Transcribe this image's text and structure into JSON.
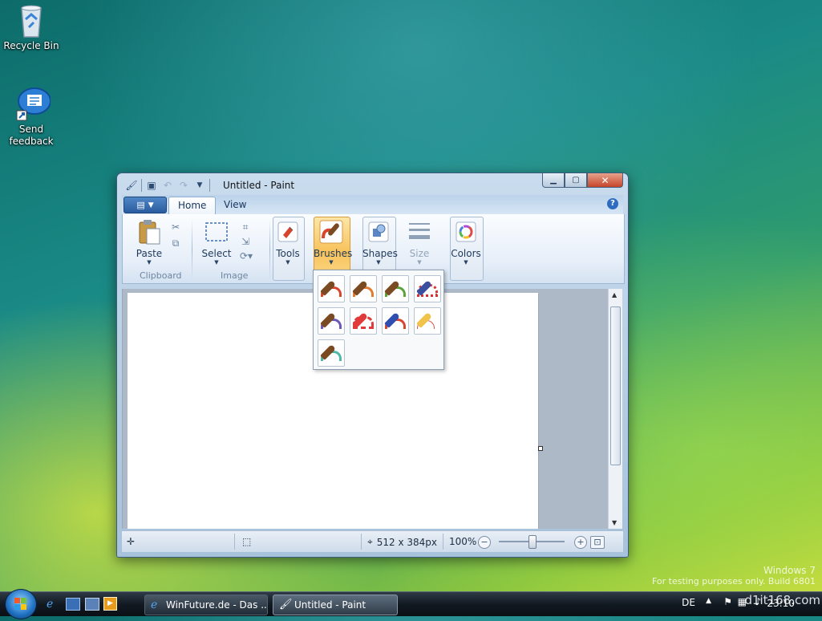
{
  "desktop": {
    "icons": [
      {
        "label": "Recycle Bin"
      },
      {
        "label": "Send feedback"
      }
    ],
    "watermark": {
      "line1": "Windows 7",
      "line2": "For testing purposes only. Build 6801"
    }
  },
  "window": {
    "title": "Untitled - Paint",
    "tabs": [
      {
        "label": "Home"
      },
      {
        "label": "View"
      }
    ],
    "help": "?"
  },
  "ribbon": {
    "paste": "Paste",
    "select": "Select",
    "tools": "Tools",
    "brushes": "Brushes",
    "shapes": "Shapes",
    "size": "Size",
    "colors": "Colors",
    "group_clipboard": "Clipboard",
    "group_image": "Image"
  },
  "brushes_menu": {
    "items": [
      {
        "name": "brush",
        "color": "#d9442b"
      },
      {
        "name": "calligraphy-brush-1",
        "color": "#e47a2e"
      },
      {
        "name": "calligraphy-brush-2",
        "color": "#5aa23a"
      },
      {
        "name": "airbrush",
        "color": "#d8322e"
      },
      {
        "name": "oil-brush",
        "color": "#6b57b8"
      },
      {
        "name": "crayon",
        "color": "#e03a3a"
      },
      {
        "name": "marker",
        "color": "#2e4fb0"
      },
      {
        "name": "natural-pencil",
        "color": "#d9534f"
      },
      {
        "name": "watercolor-brush",
        "color": "#4fb9a8"
      }
    ]
  },
  "status": {
    "size": "512 x 384px",
    "zoom": "100%"
  },
  "taskbar": {
    "buttons": [
      {
        "label": "WinFuture.de - Das ..."
      },
      {
        "label": "Untitled - Paint"
      }
    ],
    "lang": "DE",
    "time": "23:10",
    "overlay": "d1it168.com"
  }
}
